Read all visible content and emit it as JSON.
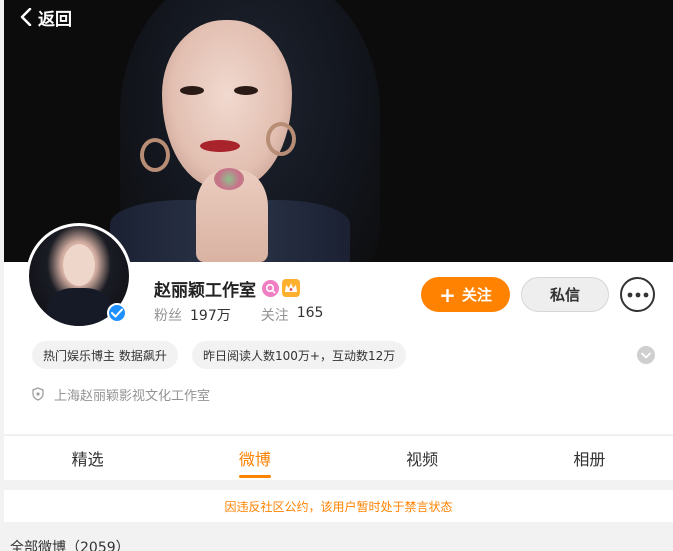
{
  "nav": {
    "back_label": "返回"
  },
  "profile": {
    "name": "赵丽颖工作室",
    "fans_label": "粉丝",
    "fans_count": "197万",
    "following_label": "关注",
    "following_count": "165",
    "tags": [
      "热门娱乐博主 数据飙升",
      "昨日阅读人数100万+，互动数12万"
    ],
    "company": "上海赵丽颖影视文化工作室"
  },
  "actions": {
    "follow_label": "关注",
    "message_label": "私信"
  },
  "tabs": [
    {
      "label": "精选",
      "active": false
    },
    {
      "label": "微博",
      "active": true
    },
    {
      "label": "视频",
      "active": false
    },
    {
      "label": "相册",
      "active": false
    }
  ],
  "notice": "因违反社区公约，该用户暂时处于禁言状态",
  "feed": {
    "all_posts_label": "全部微博（2059）"
  },
  "colors": {
    "accent": "#ff8200",
    "verify": "#1e90ff",
    "muted": "#939393"
  }
}
